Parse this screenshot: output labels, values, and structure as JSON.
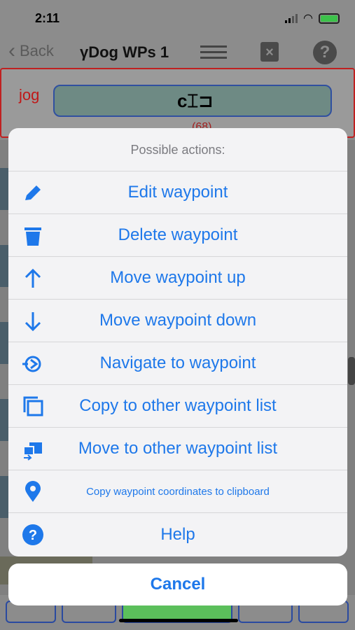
{
  "status": {
    "time": "2:11"
  },
  "nav": {
    "back_label": "Back",
    "title": "γDog WPs 1"
  },
  "jog": {
    "label": "jog",
    "glyph": "c⌶⊐",
    "count": "(68)"
  },
  "sheet": {
    "title": "Possible actions:",
    "actions": [
      {
        "label": "Edit waypoint",
        "icon": "pencil-icon"
      },
      {
        "label": "Delete waypoint",
        "icon": "trash-icon"
      },
      {
        "label": "Move waypoint up",
        "icon": "arrow-up-icon"
      },
      {
        "label": "Move waypoint down",
        "icon": "arrow-down-icon"
      },
      {
        "label": "Navigate to waypoint",
        "icon": "navigate-icon"
      },
      {
        "label": "Copy to other waypoint list",
        "icon": "copy-icon"
      },
      {
        "label": "Move to other waypoint list",
        "icon": "move-list-icon"
      },
      {
        "label": "Copy waypoint coordinates to clipboard",
        "icon": "location-pin-icon"
      },
      {
        "label": "Help",
        "icon": "help-icon"
      }
    ],
    "cancel_label": "Cancel"
  },
  "colors": {
    "accent": "#1e78ea",
    "sheet_bg": "#f3f3f5",
    "title_gray": "#7b7b80"
  }
}
